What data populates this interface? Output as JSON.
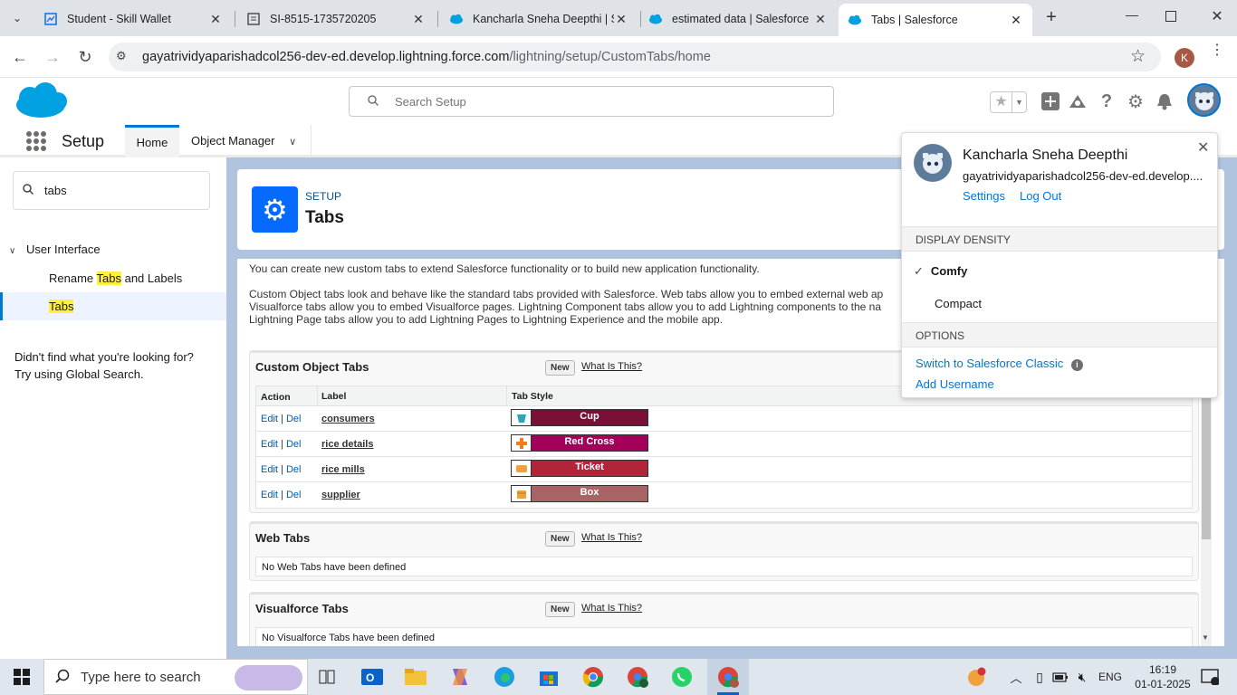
{
  "browser": {
    "tabs": [
      {
        "title": "Student - Skill Wallet",
        "active": false
      },
      {
        "title": "SI-8515-1735720205",
        "active": false
      },
      {
        "title": "Kancharla Sneha Deepthi | Sa",
        "active": false
      },
      {
        "title": "estimated data | Salesforce",
        "active": false
      },
      {
        "title": "Tabs | Salesforce",
        "active": true
      }
    ],
    "url_host": "gayatrividyaparishadcol256-dev-ed.develop.lightning.force.com",
    "url_path": "/lightning/setup/CustomTabs/home",
    "profile_initial": "K"
  },
  "header": {
    "search_placeholder": "Search Setup"
  },
  "nav": {
    "app_name": "Setup",
    "tabs": [
      "Home",
      "Object Manager"
    ]
  },
  "sidebar": {
    "search_value": "tabs",
    "group": "User Interface",
    "item_rename_pre": "Rename ",
    "item_rename_hl": "Tabs",
    "item_rename_post": " and Labels",
    "item_tabs": "Tabs",
    "help_line1": "Didn't find what you're looking for?",
    "help_line2": "Try using Global Search."
  },
  "page": {
    "eyebrow": "SETUP",
    "title": "Tabs",
    "intro1": "You can create new custom tabs to extend Salesforce functionality or to build new application functionality.",
    "intro2a": "Custom Object tabs look and behave like the standard tabs provided with Salesforce. Web tabs allow you to embed external web ap",
    "intro2b": "Visualforce tabs allow you to embed Visualforce pages. Lightning Component tabs allow you to add Lightning components to the na",
    "intro2c": "Lightning Page tabs allow you to add Lightning Pages to Lightning Experience and the mobile app."
  },
  "custom_object_tabs": {
    "title": "Custom Object Tabs",
    "new_label": "New",
    "what_label": "What Is This?",
    "col_action": "Action",
    "col_label": "Label",
    "col_style": "Tab Style",
    "edit": "Edit",
    "del": "Del",
    "rows": [
      {
        "label": "consumers",
        "style": "Cup",
        "color": "#7a1038",
        "icon_color": "#2aa7b7"
      },
      {
        "label": "rice details",
        "style": "Red Cross",
        "color": "#a3005a",
        "icon_color": "#f07c1e"
      },
      {
        "label": "rice mills",
        "style": "Ticket",
        "color": "#b2243a",
        "icon_color": "#f0a03c"
      },
      {
        "label": "supplier",
        "style": "Box",
        "color": "#a86464",
        "icon_color": "#f0a03c"
      }
    ]
  },
  "web_tabs": {
    "title": "Web Tabs",
    "new_label": "New",
    "what_label": "What Is This?",
    "empty": "No Web Tabs have been defined"
  },
  "visualforce_tabs": {
    "title": "Visualforce Tabs",
    "new_label": "New",
    "what_label": "What Is This?",
    "empty": "No Visualforce Tabs have been defined"
  },
  "user_menu": {
    "name": "Kancharla Sneha Deepthi",
    "domain": "gayatrividyaparishadcol256-dev-ed.develop....",
    "settings": "Settings",
    "logout": "Log Out",
    "density_header": "DISPLAY DENSITY",
    "density_options": [
      "Comfy",
      "Compact"
    ],
    "density_selected": "Comfy",
    "options_header": "OPTIONS",
    "switch_classic": "Switch to Salesforce Classic",
    "add_username": "Add Username"
  },
  "taskbar": {
    "search_placeholder": "Type here to search",
    "lang": "ENG",
    "time": "16:19",
    "date": "01-01-2025"
  },
  "colors": {
    "salesforce_blue": "#00a1e0",
    "link": "#0176d3",
    "setup_icon": "#066afe"
  }
}
